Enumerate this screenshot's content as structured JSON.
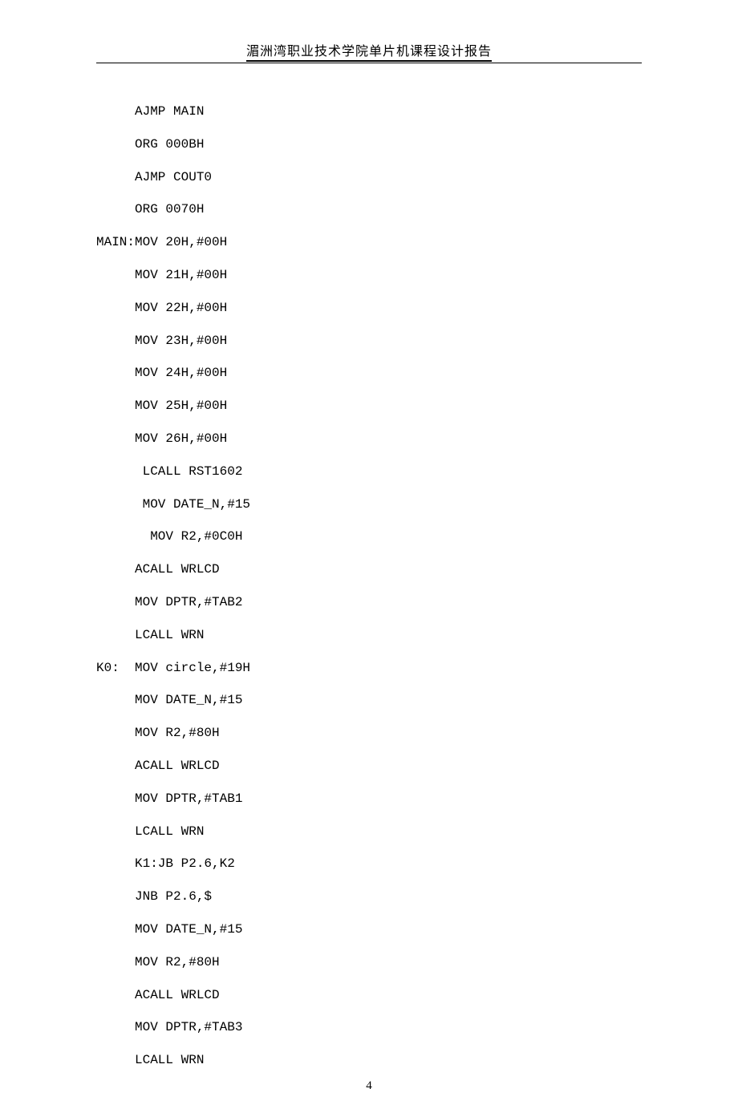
{
  "header": {
    "title": "湄洲湾职业技术学院单片机课程设计报告"
  },
  "code": {
    "lines": [
      {
        "label": "",
        "text": "AJMP MAIN"
      },
      {
        "label": "",
        "text": "ORG 000BH"
      },
      {
        "label": "",
        "text": "AJMP COUT0"
      },
      {
        "label": "",
        "text": "ORG 0070H"
      },
      {
        "label": "MAIN:",
        "text": "MOV 20H,#00H"
      },
      {
        "label": "",
        "text": "MOV 21H,#00H"
      },
      {
        "label": "",
        "text": "MOV 22H,#00H"
      },
      {
        "label": "",
        "text": "MOV 23H,#00H"
      },
      {
        "label": "",
        "text": "MOV 24H,#00H"
      },
      {
        "label": "",
        "text": "MOV 25H,#00H"
      },
      {
        "label": "",
        "text": "MOV 26H,#00H"
      },
      {
        "label": "",
        "text": " LCALL RST1602"
      },
      {
        "label": "",
        "text": " MOV DATE_N,#15"
      },
      {
        "label": "",
        "text": "  MOV R2,#0C0H"
      },
      {
        "label": "",
        "text": "ACALL WRLCD"
      },
      {
        "label": "",
        "text": "MOV DPTR,#TAB2"
      },
      {
        "label": "",
        "text": "LCALL WRN"
      },
      {
        "label": "K0:",
        "text": "MOV circle,#19H"
      },
      {
        "label": "",
        "text": "MOV DATE_N,#15"
      },
      {
        "label": "",
        "text": "MOV R2,#80H"
      },
      {
        "label": "",
        "text": "ACALL WRLCD"
      },
      {
        "label": "",
        "text": "MOV DPTR,#TAB1"
      },
      {
        "label": "",
        "text": "LCALL WRN"
      },
      {
        "label": "",
        "text": "K1:JB P2.6,K2"
      },
      {
        "label": "",
        "text": "JNB P2.6,$"
      },
      {
        "label": "",
        "text": "MOV DATE_N,#15"
      },
      {
        "label": "",
        "text": "MOV R2,#80H"
      },
      {
        "label": "",
        "text": "ACALL WRLCD"
      },
      {
        "label": "",
        "text": "MOV DPTR,#TAB3"
      },
      {
        "label": "",
        "text": "LCALL WRN"
      }
    ]
  },
  "footer": {
    "page_number": "4"
  }
}
